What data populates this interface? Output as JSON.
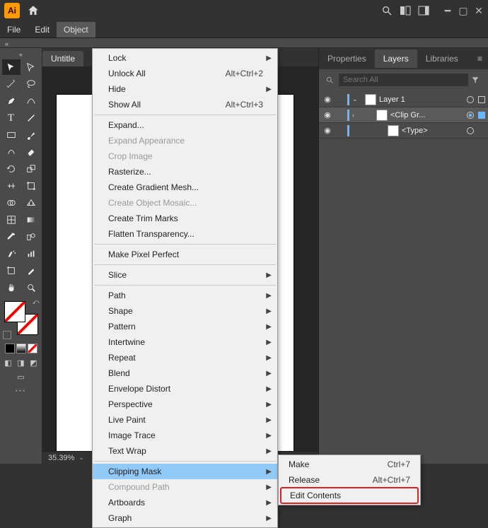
{
  "titlebar": {
    "app_abbrev": "Ai"
  },
  "menubar": {
    "file": "File",
    "edit": "Edit",
    "object": "Object"
  },
  "doc_tab": "Untitle",
  "status_zoom": "35.39%",
  "panel_tabs": {
    "properties": "Properties",
    "layers": "Layers",
    "libraries": "Libraries"
  },
  "layers_search_placeholder": "Search All",
  "layers": [
    {
      "label": "Layer 1"
    },
    {
      "label": "<Clip Gr..."
    },
    {
      "label": "<Type>"
    }
  ],
  "object_menu": {
    "lock": "Lock",
    "unlock_all": {
      "label": "Unlock All",
      "shortcut": "Alt+Ctrl+2"
    },
    "hide": "Hide",
    "show_all": {
      "label": "Show All",
      "shortcut": "Alt+Ctrl+3"
    },
    "expand": "Expand...",
    "expand_appearance": "Expand Appearance",
    "crop_image": "Crop Image",
    "rasterize": "Rasterize...",
    "create_gradient_mesh": "Create Gradient Mesh...",
    "create_object_mosaic": "Create Object Mosaic...",
    "create_trim_marks": "Create Trim Marks",
    "flatten_transparency": "Flatten Transparency...",
    "make_pixel_perfect": "Make Pixel Perfect",
    "slice": "Slice",
    "path": "Path",
    "shape": "Shape",
    "pattern": "Pattern",
    "intertwine": "Intertwine",
    "repeat": "Repeat",
    "blend": "Blend",
    "envelope_distort": "Envelope Distort",
    "perspective": "Perspective",
    "live_paint": "Live Paint",
    "image_trace": "Image Trace",
    "text_wrap": "Text Wrap",
    "clipping_mask": "Clipping Mask",
    "compound_path": "Compound Path",
    "artboards": "Artboards",
    "graph": "Graph"
  },
  "clipping_submenu": {
    "make": {
      "label": "Make",
      "shortcut": "Ctrl+7"
    },
    "release": {
      "label": "Release",
      "shortcut": "Alt+Ctrl+7"
    },
    "edit_contents": "Edit Contents"
  }
}
